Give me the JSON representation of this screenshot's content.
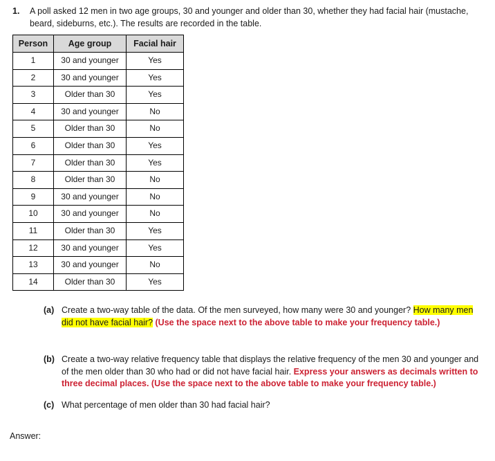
{
  "question": {
    "number": "1.",
    "text": "A poll asked 12 men in two age groups, 30 and younger and older than 30, whether they had facial hair (mustache, beard, sideburns, etc.). The results are recorded in the table."
  },
  "table": {
    "headers": [
      "Person",
      "Age group",
      "Facial hair"
    ],
    "rows": [
      [
        "1",
        "30 and younger",
        "Yes"
      ],
      [
        "2",
        "30 and younger",
        "Yes"
      ],
      [
        "3",
        "Older than 30",
        "Yes"
      ],
      [
        "4",
        "30 and younger",
        "No"
      ],
      [
        "5",
        "Older than 30",
        "No"
      ],
      [
        "6",
        "Older than 30",
        "Yes"
      ],
      [
        "7",
        "Older than 30",
        "Yes"
      ],
      [
        "8",
        "Older than 30",
        "No"
      ],
      [
        "9",
        "30 and younger",
        "No"
      ],
      [
        "10",
        "30 and younger",
        "No"
      ],
      [
        "11",
        "Older than 30",
        "Yes"
      ],
      [
        "12",
        "30 and younger",
        "Yes"
      ],
      [
        "13",
        "30 and younger",
        "No"
      ],
      [
        "14",
        "Older than 30",
        "Yes"
      ]
    ]
  },
  "parts": {
    "a": {
      "label": "(a)",
      "plain_1": "Create a two-way table of the data. Of the men surveyed, how many were 30 and younger? ",
      "highlight": "How many men did not have facial hair?",
      "red": " (Use the space next to the above table to make your frequency table.)"
    },
    "b": {
      "label": "(b)",
      "plain_1": "Create a two-way relative frequency table that displays the relative frequency of the men 30 and younger and of the men older than 30 who had or did not have facial hair. ",
      "red": "Express your answers as decimals written to three decimal places. (Use the space next to the above table to make your frequency table.)"
    },
    "c": {
      "label": "(c)",
      "plain_1": "What percentage of men older than 30 had facial hair?"
    }
  },
  "answer": {
    "label": "Answer:"
  },
  "colors": {
    "highlight": "#ffff00",
    "red": "#cc2233",
    "header_bg": "#d9d9d9",
    "border": "#000000"
  }
}
